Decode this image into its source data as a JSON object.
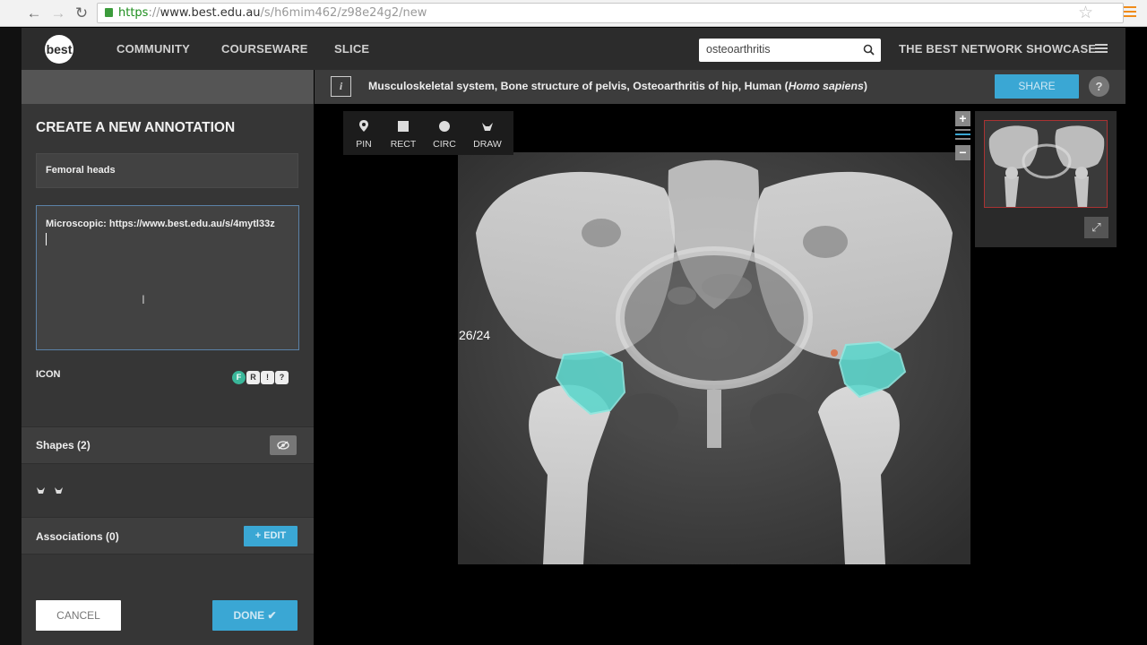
{
  "browser": {
    "back_glyph": "←",
    "forward_glyph": "→",
    "reload_glyph": "↻",
    "url_scheme": "https",
    "url_sep": "://",
    "url_host": "www.best.edu.au",
    "url_path": "/s/h6mim462/z98e24g2/new",
    "star_glyph": "☆"
  },
  "topnav": {
    "logo_text": "best",
    "links": [
      "COMMUNITY",
      "COURSEWARE",
      "SLICE"
    ],
    "search_value": "osteoarthritis",
    "showcase_label": "THE BEST NETWORK SHOWCASE"
  },
  "panel": {
    "title": "CREATE A NEW ANNOTATION",
    "name_value": "Femoral heads",
    "description_value": "Microscopic: https://www.best.edu.au/s/4mytl33z",
    "icon_label": "ICON",
    "icon_badges": [
      "F",
      "R",
      "!",
      "?"
    ],
    "shapes_label": "Shapes (2)",
    "associations_label": "Associations (0)",
    "edit_label": "+ EDIT",
    "cancel_label": "CANCEL",
    "done_label": "DONE ✔"
  },
  "viewer": {
    "info_glyph": "i",
    "title_prefix": "Musculoskeletal system, Bone structure of pelvis, Osteoarthritis of hip, Human (",
    "title_species": "Homo sapiens",
    "title_suffix": ")",
    "share_label": "SHARE",
    "help_glyph": "?",
    "slice_indicator": "26/24",
    "tools": [
      {
        "label": "PIN",
        "icon": "pin-icon"
      },
      {
        "label": "RECT",
        "icon": "rect-icon"
      },
      {
        "label": "CIRC",
        "icon": "circle-icon"
      },
      {
        "label": "DRAW",
        "icon": "draw-icon"
      }
    ],
    "zoom_in_glyph": "+",
    "zoom_out_glyph": "−",
    "fullscreen_glyph": "⤢"
  },
  "colors": {
    "accent": "#3aa7d4",
    "annotation_fill": "#5fd6cc",
    "badge_f": "#3ab79a"
  }
}
